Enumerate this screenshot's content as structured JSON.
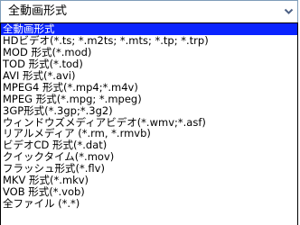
{
  "format_select": {
    "value": "全動画形式",
    "icon": "chevron-down-icon",
    "colors": {
      "border": "#7f9db9",
      "arrow": "#4d6185",
      "highlight": "#0a24ff",
      "highlight_text": "#ffffff"
    },
    "options": [
      "全動画形式",
      "HDビデオ(*.ts; *.m2ts; *.mts; *.tp; *.trp)",
      "MOD 形式(*.mod)",
      "TOD 形式(*.tod)",
      "AVI 形式(*.avi)",
      "MPEG4 形式(*.mp4;*.m4v)",
      "MPEG 形式(*.mpg; *.mpeg)",
      "3GP形式(*.3gp;*.3g2)",
      "ウィンドウズメディアビデオ(*.wmv;*.asf)",
      "リアルメディア (*.rm, *.rmvb)",
      "ビデオCD 形式(*.dat)",
      "クイックタイム(*.mov)",
      "フラッシュ形式(*.flv)",
      "MKV 形式(*.mkv)",
      "VOB 形式(*.vob)",
      "全ファイル (*.*)"
    ],
    "selected_index": 0
  }
}
